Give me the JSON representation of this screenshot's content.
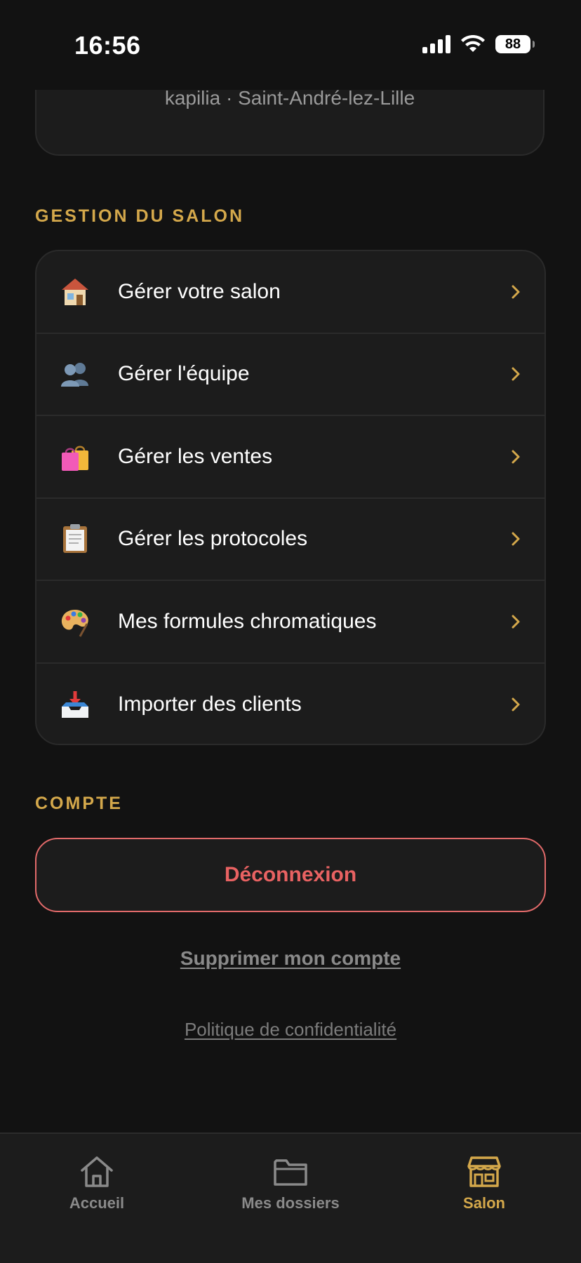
{
  "status_bar": {
    "time": "16:56",
    "battery": "88"
  },
  "profile_card": {
    "subtitle": "kapilia · Saint-André-lez-Lille"
  },
  "salon_section": {
    "title": "GESTION DU SALON",
    "items": [
      {
        "label": "Gérer votre salon",
        "icon": "house-icon"
      },
      {
        "label": "Gérer l'équipe",
        "icon": "team-icon"
      },
      {
        "label": "Gérer les ventes",
        "icon": "shopping-bags-icon"
      },
      {
        "label": "Gérer les protocoles",
        "icon": "clipboard-icon"
      },
      {
        "label": "Mes formules chromatiques",
        "icon": "palette-icon"
      },
      {
        "label": "Importer des clients",
        "icon": "inbox-tray-icon"
      }
    ]
  },
  "account_section": {
    "title": "COMPTE",
    "logout_label": "Déconnexion",
    "delete_label": "Supprimer mon compte",
    "privacy_label": "Politique de confidentialité"
  },
  "bottom_nav": {
    "items": [
      {
        "label": "Accueil",
        "icon": "home-icon",
        "active": false
      },
      {
        "label": "Mes dossiers",
        "icon": "folder-icon",
        "active": false
      },
      {
        "label": "Salon",
        "icon": "storefront-icon",
        "active": true
      }
    ]
  },
  "colors": {
    "background": "#121212",
    "card": "#1c1c1c",
    "accent": "#d4a84b",
    "danger": "#e86262",
    "muted": "#8a8a8a"
  }
}
